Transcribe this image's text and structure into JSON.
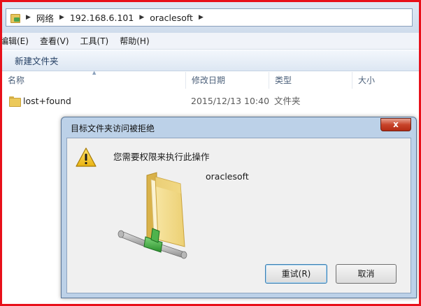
{
  "address": {
    "crumbs": [
      "网络",
      "192.168.6.101",
      "oraclesoft"
    ]
  },
  "menu": {
    "items": [
      "编辑(E)",
      "查看(V)",
      "工具(T)",
      "帮助(H)"
    ]
  },
  "toolbar": {
    "new_folder": "新建文件夹"
  },
  "columns": {
    "name": "名称",
    "modified": "修改日期",
    "type": "类型",
    "size": "大小"
  },
  "files": [
    {
      "name": "lost+found",
      "modified": "2015/12/13 10:40",
      "type": "文件夹"
    }
  ],
  "dialog": {
    "title": "目标文件夹访问被拒绝",
    "close": "x",
    "message": "您需要权限来执行此操作",
    "target": "oraclesoft",
    "retry": "重试(R)",
    "cancel": "取消"
  },
  "colors": {
    "frame": "#e8101a",
    "dialog_frame": "#bcd1e8",
    "close_red": "#c8432a"
  }
}
